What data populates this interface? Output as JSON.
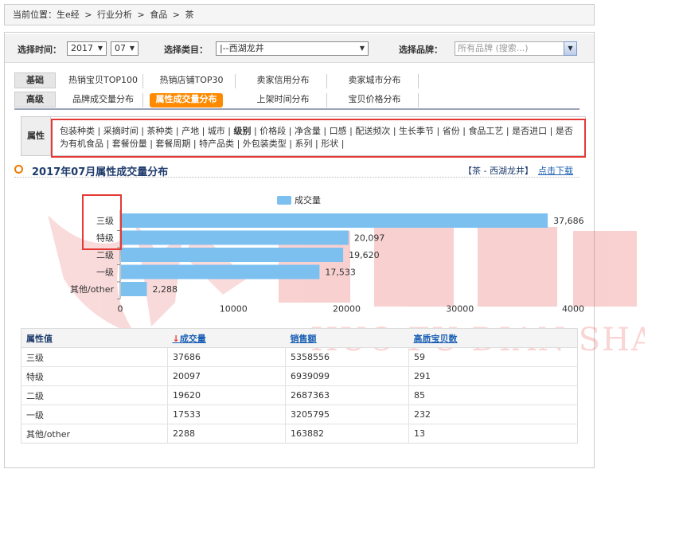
{
  "breadcrumb": [
    "当前位置：生e经",
    ">",
    "行业分析",
    ">",
    "食品",
    ">",
    "茶"
  ],
  "filters": {
    "time_label": "选择时间：",
    "year": "2017",
    "month": "07",
    "category_label": "选择类目：",
    "category": "|--西湖龙井",
    "brand_label": "选择品牌：",
    "brand_placeholder": "所有品牌 (搜索...)"
  },
  "tabs": {
    "basic_label": "基础",
    "advanced_label": "高级",
    "basic": [
      "热销宝贝TOP100",
      "热销店铺TOP30",
      "卖家信用分布",
      "卖家城市分布"
    ],
    "advanced": [
      "品牌成交量分布",
      "属性成交量分布",
      "上架时间分布",
      "宝贝价格分布"
    ],
    "active": "属性成交量分布"
  },
  "attributes": {
    "label": "属性",
    "items": [
      "包装种类",
      "采摘时间",
      "茶种类",
      "产地",
      "城市",
      "级别",
      "价格段",
      "净含量",
      "口感",
      "配送频次",
      "生长季节",
      "省份",
      "食品工艺",
      "是否进口",
      "是否为有机食品",
      "套餐份量",
      "套餐周期",
      "特产品类",
      "外包装类型",
      "系列",
      "形状"
    ],
    "current": "级别"
  },
  "section": {
    "title": "2017年07月属性成交量分布",
    "tag": "【茶 - 西湖龙井】",
    "download": "点击下载"
  },
  "chart_data": {
    "type": "bar",
    "orientation": "horizontal",
    "categories": [
      "三级",
      "特级",
      "二级",
      "一级",
      "其他/other"
    ],
    "series": [
      {
        "name": "成交量",
        "values": [
          37686,
          20097,
          19620,
          17533,
          2288
        ]
      }
    ],
    "data_labels": [
      "37,686",
      "20,097",
      "19,620",
      "17,533",
      "2,288"
    ],
    "xlim": [
      0,
      40000
    ],
    "xticks": [
      "0",
      "10000",
      "20000",
      "30000",
      "4000"
    ],
    "legend": "top-center",
    "bar_color": "#7cc0f0"
  },
  "table": {
    "headers": [
      "属性值",
      "↓成交量",
      "销售额",
      "高质宝贝数"
    ],
    "rows": [
      [
        "三级",
        "37686",
        "5358556",
        "59"
      ],
      [
        "特级",
        "20097",
        "6939099",
        "291"
      ],
      [
        "二级",
        "19620",
        "2687363",
        "85"
      ],
      [
        "一级",
        "17533",
        "3205795",
        "232"
      ],
      [
        "其他/other",
        "2288",
        "163882",
        "13"
      ]
    ]
  },
  "watermark": {
    "main": "火蝠电商",
    "sub": "HUO FU DIAN SHANG"
  }
}
